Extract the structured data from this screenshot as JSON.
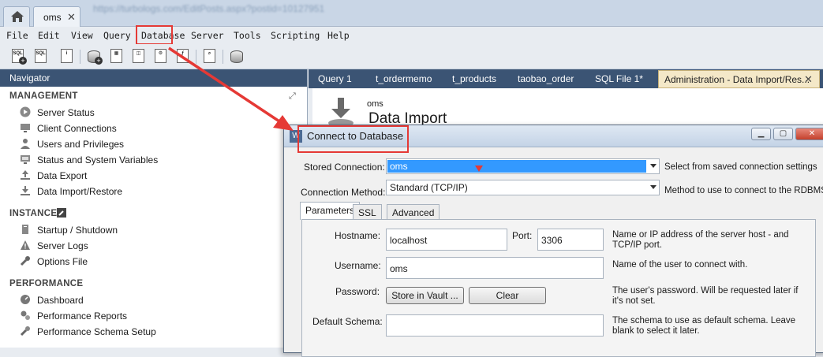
{
  "tabstrip": {
    "connection_tab": "oms",
    "close_glyph": "✕",
    "url": "https://turbologs.com/EditPosts.aspx?postid=10127951"
  },
  "menubar": {
    "items": [
      "File",
      "Edit",
      "View",
      "Query",
      "Database",
      "Server",
      "Tools",
      "Scripting",
      "Help"
    ],
    "highlighted": "Database"
  },
  "navigator": {
    "title": "Navigator",
    "sections": {
      "management": {
        "title": "MANAGEMENT",
        "items": [
          "Server Status",
          "Client Connections",
          "Users and Privileges",
          "Status and System Variables",
          "Data Export",
          "Data Import/Restore"
        ]
      },
      "instance": {
        "title": "INSTANCE",
        "items": [
          "Startup / Shutdown",
          "Server Logs",
          "Options File"
        ]
      },
      "performance": {
        "title": "PERFORMANCE",
        "items": [
          "Dashboard",
          "Performance Reports",
          "Performance Schema Setup"
        ]
      }
    }
  },
  "query_tabs": {
    "items": [
      "Query 1",
      "t_ordermemo",
      "t_products",
      "taobao_order",
      "SQL File 1*"
    ],
    "active": "Administration - Data Import/Res..."
  },
  "admin": {
    "connection": "oms",
    "title": "Data Import"
  },
  "dialog": {
    "title": "Connect to Database",
    "stored_connection": {
      "label": "Stored Connection:",
      "value": "oms",
      "desc": "Select from saved connection settings"
    },
    "connection_method": {
      "label": "Connection Method:",
      "value": "Standard (TCP/IP)",
      "desc": "Method to use to connect to the RDBMS"
    },
    "tabs": [
      "Parameters",
      "SSL",
      "Advanced"
    ],
    "hostname": {
      "label": "Hostname:",
      "value": "localhost",
      "desc": "Name or IP address of the server host - and TCP/IP port."
    },
    "port": {
      "label": "Port:",
      "value": "3306"
    },
    "username": {
      "label": "Username:",
      "value": "oms",
      "desc": "Name of the user to connect with."
    },
    "password": {
      "label": "Password:",
      "store_button": "Store in Vault ...",
      "clear_button": "Clear",
      "desc": "The user's password. Will be requested later if it's not set."
    },
    "default_schema": {
      "label": "Default Schema:",
      "value": "",
      "desc": "The schema to use as default schema. Leave blank to select it later."
    }
  },
  "colors": {
    "accent_red": "#e53935",
    "nav_header": "#3b5474",
    "selection_blue": "#3399ff"
  }
}
